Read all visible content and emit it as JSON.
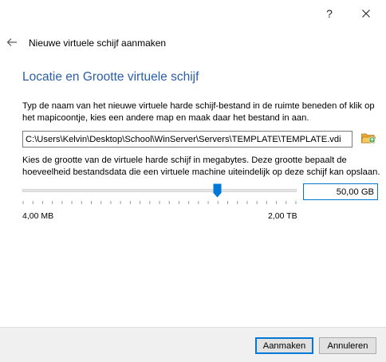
{
  "titlebar": {
    "help_label": "?",
    "close_icon": "close-icon"
  },
  "wizard": {
    "title": "Nieuwe virtuele schijf aanmaken",
    "back_icon": "back-arrow-icon"
  },
  "page": {
    "heading": "Locatie en Grootte virtuele schijf",
    "location_description": "Typ de naam van het nieuwe virtuele harde schijf-bestand in de ruimte beneden of klik op het mapicoontje, kies een andere map en maak daar het bestand in aan.",
    "file_path": "C:\\Users\\Kelvin\\Desktop\\School\\WinServer\\Servers\\TEMPLATE\\TEMPLATE.vdi",
    "folder_icon": "folder-icon",
    "size_description": "Kies de grootte van de virtuele harde schijf in megabytes. Deze grootte bepaalt de hoeveelheid bestandsdata die een virtuele machine uiteindelijk op deze schijf kan opslaan.",
    "size_value": "50,00 GB",
    "slider": {
      "min_label": "4,00 MB",
      "max_label": "2,00 TB",
      "handle_fraction": 0.71
    }
  },
  "footer": {
    "create_label": "Aanmaken",
    "cancel_label": "Annuleren"
  },
  "colors": {
    "heading": "#2a5ea8",
    "accent": "#0078d7",
    "footer_bg": "#f0f0f0"
  }
}
